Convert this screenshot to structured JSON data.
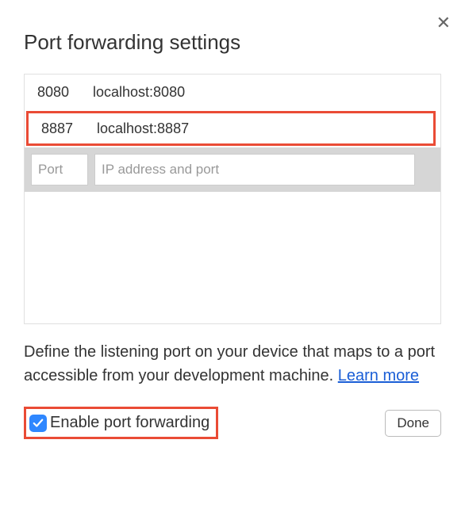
{
  "title": "Port forwarding settings",
  "mappings": [
    {
      "port": "8080",
      "address": "localhost:8080",
      "highlighted": false
    },
    {
      "port": "8887",
      "address": "localhost:8887",
      "highlighted": true
    }
  ],
  "inputs": {
    "port_placeholder": "Port",
    "address_placeholder": "IP address and port"
  },
  "description": "Define the listening port on your device that maps to a port accessible from your development machine. ",
  "learn_more": "Learn more",
  "enable_label": "Enable port forwarding",
  "enable_checked": true,
  "done_label": "Done"
}
